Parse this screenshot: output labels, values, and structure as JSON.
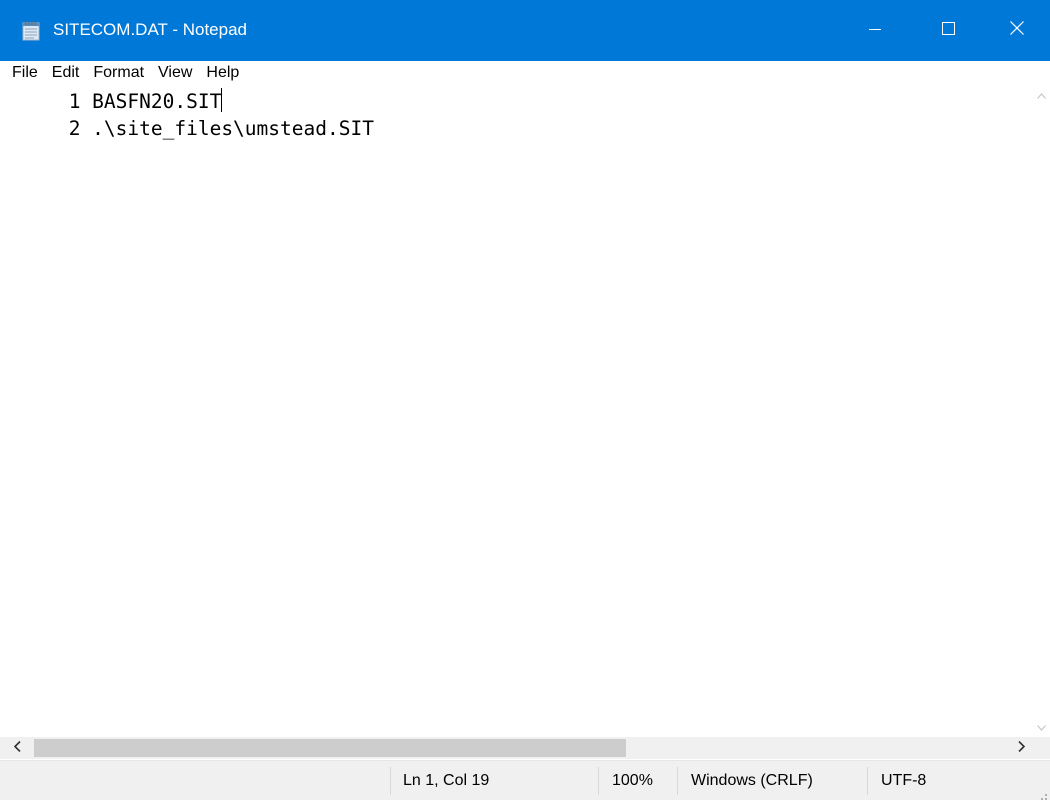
{
  "window": {
    "title": "SITECOM.DAT - Notepad",
    "accent_color": "#0078d7",
    "icons": {
      "app": "notepad-icon",
      "minimize": "minimize-icon",
      "maximize": "maximize-icon",
      "close": "close-icon"
    }
  },
  "menu": {
    "items": [
      "File",
      "Edit",
      "Format",
      "View",
      "Help"
    ]
  },
  "editor": {
    "lines": [
      "     1 BASFN20.SIT",
      "     2 .\\site_files\\umstead.SIT"
    ]
  },
  "scrollbars": {
    "vertical_up_icon": "chevron-up-icon",
    "vertical_down_icon": "chevron-down-icon",
    "horizontal_left_icon": "chevron-left-icon",
    "horizontal_right_icon": "chevron-right-icon"
  },
  "status": {
    "position": "Ln 1, Col 19",
    "zoom": "100%",
    "line_ending": "Windows (CRLF)",
    "encoding": "UTF-8"
  }
}
